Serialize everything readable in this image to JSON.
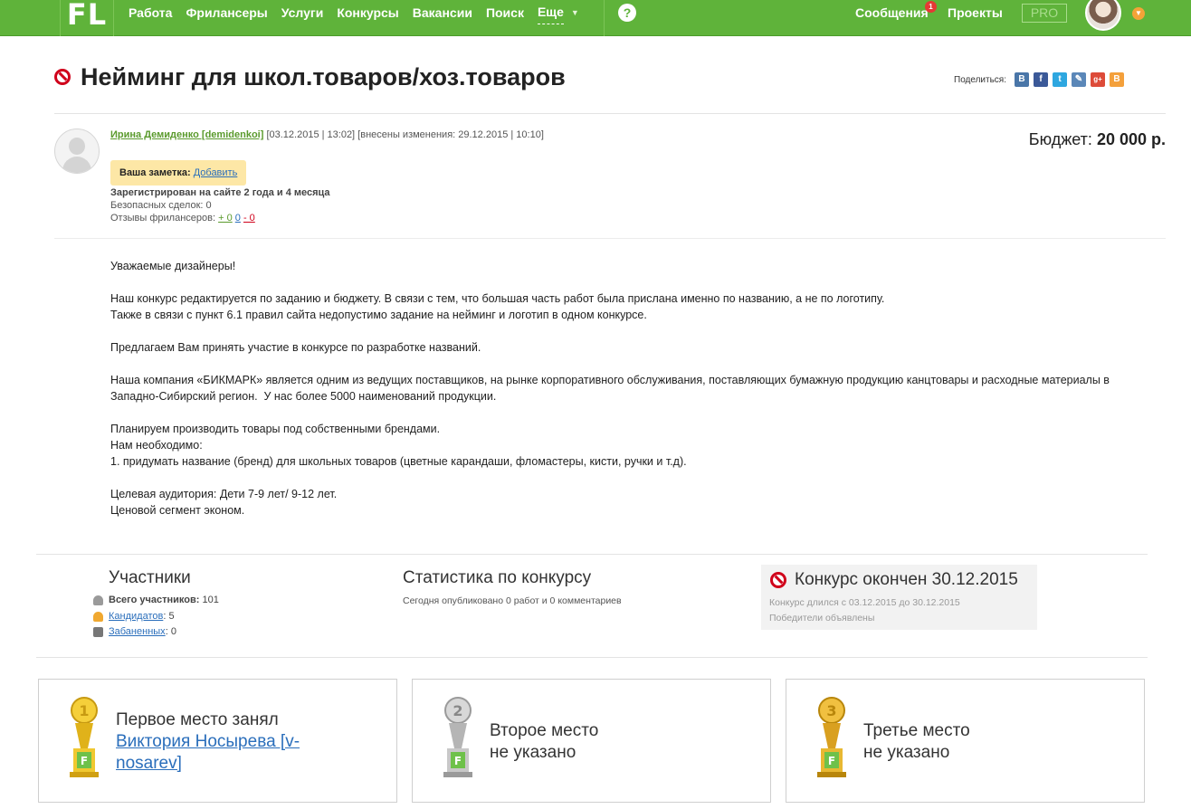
{
  "topbar": {
    "logo": "FL",
    "nav": [
      "Работа",
      "Фрилансеры",
      "Услуги",
      "Конкурсы",
      "Вакансии",
      "Поиск"
    ],
    "more_label": "Еще",
    "help_label": "?",
    "messages_label": "Сообщения",
    "messages_count": "1",
    "projects_label": "Проекты",
    "pro_label": "PRO",
    "colors": {
      "bar": "#5fb33a"
    }
  },
  "project": {
    "title": "Нейминг для школ.товаров/хоз.товаров",
    "share_label": "Поделиться:",
    "budget_label": "Бюджет:",
    "budget_value": "20 000 р."
  },
  "share_icons": [
    {
      "name": "vk-icon",
      "glyph": "B",
      "color": "#4a76a8"
    },
    {
      "name": "facebook-icon",
      "glyph": "f",
      "color": "#3b5998"
    },
    {
      "name": "twitter-icon",
      "glyph": "t",
      "color": "#2ea7e0"
    },
    {
      "name": "livejournal-icon",
      "glyph": "✎",
      "color": "#5b87b8"
    },
    {
      "name": "googleplus-icon",
      "glyph": "g+",
      "color": "#dd4b39"
    },
    {
      "name": "blogger-icon",
      "glyph": "B",
      "color": "#f4a03b"
    }
  ],
  "author": {
    "name": "Ирина Демиденко [demidenkoi]",
    "dates": "[03.12.2015 | 13:02] [внесены изменения: 29.12.2015 | 10:10]",
    "note_label": "Ваша заметка:",
    "note_add": "Добавить",
    "registered": "Зарегистрирован на сайте 2 года и 4 месяца",
    "deals": "Безопасных сделок: 0",
    "reviews_label": "Отзывы фрилансеров:",
    "reviews_pos": "+ 0",
    "reviews_neu": "0",
    "reviews_neg": "- 0"
  },
  "description": [
    "Уважаемые дизайнеры!",
    "",
    "Наш конкурс редактируется по заданию и бюджету. В связи с тем, что большая часть работ была прислана именно по названию, а не по логотипу.",
    "Также в связи с пункт 6.1 правил сайта недопустимо задание на нейминг и логотип в одном конкурсе.",
    "",
    "Предлагаем Вам принять участие в конкурсе по разработке названий.",
    "",
    "Наша компания «БИКМАРК» является одним из ведущих поставщиков, на рынке корпоративного обслуживания, поставляющих бумажную продукцию канцтовары и расходные материалы в",
    "Западно-Сибирский регион.  У нас более 5000 наименований продукции.",
    "",
    "Планируем производить товары под собственными брендами.",
    "Нам необходимо:",
    "1. придумать название (бренд) для школьных товаров (цветные карандаши, фломастеры, кисти, ручки и т.д).",
    "",
    "Целевая аудитория: Дети 7-9 лет/ 9-12 лет.",
    "Ценовой сегмент эконом."
  ],
  "participants": {
    "title": "Участники",
    "total_label": "Всего участников:",
    "total_value": "101",
    "candidates_label": "Кандидатов",
    "candidates_value": "5",
    "banned_label": "Забаненных",
    "banned_value": "0"
  },
  "stats": {
    "title": "Статистика по конкурсу",
    "text": "Сегодня опубликовано 0 работ и 0 комментариев"
  },
  "ended": {
    "title": "Конкурс окончен 30.12.2015",
    "duration": "Конкурс длился с 03.12.2015 до 30.12.2015",
    "winners": "Победители объявлены"
  },
  "places": [
    {
      "line1": "Первое место занял",
      "winner": "Виктория Носырева [v-",
      "winner2": "nosarev]",
      "digit": "1",
      "color": "#e0b21a"
    },
    {
      "line1": "Второе место",
      "line2": "не указано",
      "digit": "2",
      "color": "#b5b5b5"
    },
    {
      "line1": "Третье место",
      "line2": "не указано",
      "digit": "3",
      "color": "#d9a020"
    }
  ]
}
